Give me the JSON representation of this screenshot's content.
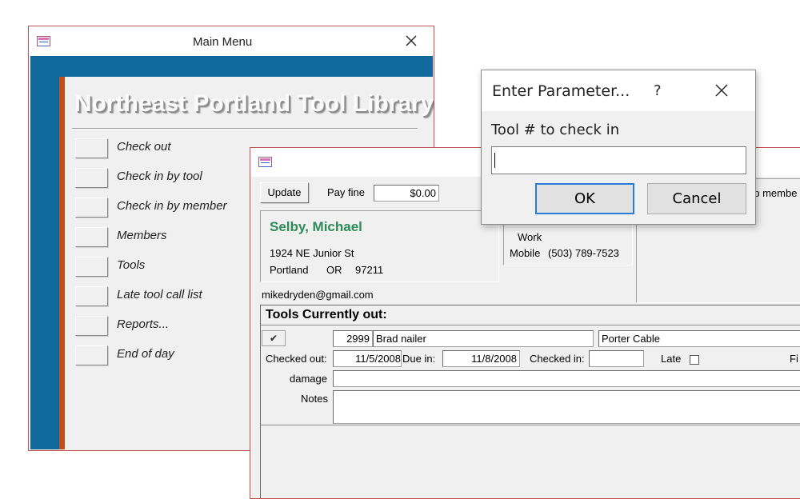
{
  "main_menu": {
    "title": "Main Menu",
    "header": "Northeast Portland Tool Library",
    "items": [
      {
        "label": "Check out"
      },
      {
        "label": "Check in by tool"
      },
      {
        "label": "Check in by member"
      },
      {
        "label": "Members"
      },
      {
        "label": "Tools"
      },
      {
        "label": "Late tool call list"
      },
      {
        "label": "Reports..."
      },
      {
        "label": "End of day"
      }
    ]
  },
  "checkin_form": {
    "update_label": "Update",
    "pay_fine_label": "Pay fine",
    "pay_fine_value": "$0.00",
    "member_name": "Selby, Michael",
    "address_line": "1924 NE Junior St",
    "city": "Portland",
    "state": "OR",
    "zip": "97211",
    "work_label": "Work",
    "mobile_label": "Mobile",
    "mobile_value": "(503) 789-7523",
    "email": "mikedryden@gmail.com",
    "group_label_partial": "up membe",
    "tools_header": "Tools Currently out:",
    "tool_row": {
      "checkbox_mark": "✔",
      "tool_number": "2999",
      "tool_name": "Brad nailer",
      "brand": "Porter Cable",
      "checked_out_label": "Checked out:",
      "checked_out_value": "11/5/2008",
      "due_in_label": "Due in:",
      "due_in_value": "11/8/2008",
      "checked_in_label": "Checked in:",
      "checked_in_value": "",
      "late_label": "Late",
      "fine_label_partial": "Fi",
      "damage_label": "damage",
      "damage_value": "",
      "notes_label": "Notes",
      "notes_value": ""
    }
  },
  "param_dialog": {
    "title": "Enter Parameter...",
    "help_label": "?",
    "prompt": "Tool # to check in",
    "input_value": "",
    "ok_label": "OK",
    "cancel_label": "Cancel"
  },
  "colors": {
    "main_menu_banner": "#10699a",
    "accent_orange": "#c0501c",
    "member_name_green": "#2e8b57",
    "window_border": "#c0504d",
    "ok_button_border": "#2a7bd4"
  },
  "icons": [
    "app-form-icon",
    "close-icon",
    "help-icon",
    "checkbox-checked-icon"
  ]
}
